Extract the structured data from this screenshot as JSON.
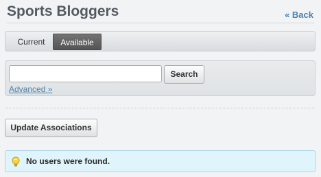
{
  "header": {
    "title": "Sports Bloggers",
    "back_link": "« Back"
  },
  "tabs": [
    {
      "label": "Current",
      "selected": false
    },
    {
      "label": "Available",
      "selected": true
    }
  ],
  "search": {
    "value": "",
    "button_label": "Search",
    "advanced_link": "Advanced »"
  },
  "actions": {
    "update_label": "Update Associations"
  },
  "message": {
    "text": "No users were found.",
    "icon": "lightbulb-icon"
  },
  "colors": {
    "accent_link": "#4c84b0",
    "active_tab": "#5c5c5c",
    "info_background": "#dff4fb"
  }
}
